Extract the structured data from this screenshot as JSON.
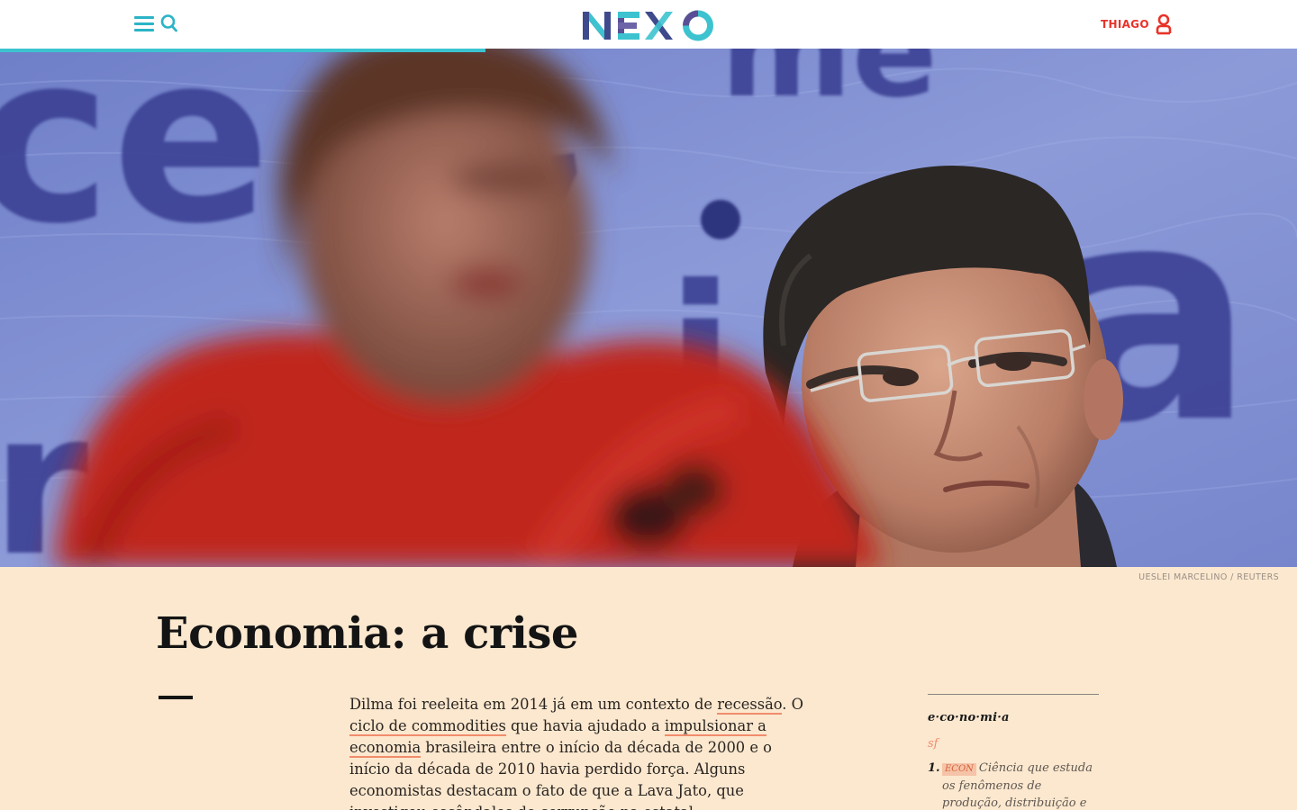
{
  "header": {
    "logo_text": "NEXO",
    "user_name": "THIAGO",
    "read_progress": 0.374,
    "accent_color": "#3cc3cf",
    "user_color": "#e8332a"
  },
  "hero": {
    "credit": "UESLEI MARCELINO / REUTERS"
  },
  "article": {
    "title": "Economia: a crise",
    "p_seg1": "Dilma foi reeleita em 2014 já em um contexto de ",
    "link_recessao": "recessão",
    "p_seg2": ". O ",
    "link_commodities": "ciclo de commodities",
    "p_seg3": " que havia ajudado a ",
    "link_impulsionar": "impulsionar a economia",
    "p_seg4": " brasileira entre o início da década de 2000 e o início da década de 2010 havia perdido força. Alguns economistas destacam o fato de que a Lava Jato, que investigou escândalos de corrupção na estatal"
  },
  "dictionary": {
    "word": "e·co·no·mi·a",
    "word_class": "sf",
    "definition_number": "1.",
    "tag": "ECON",
    "definition": "Ciência que estuda os fenômenos de produção, distribuição e consumo de"
  }
}
